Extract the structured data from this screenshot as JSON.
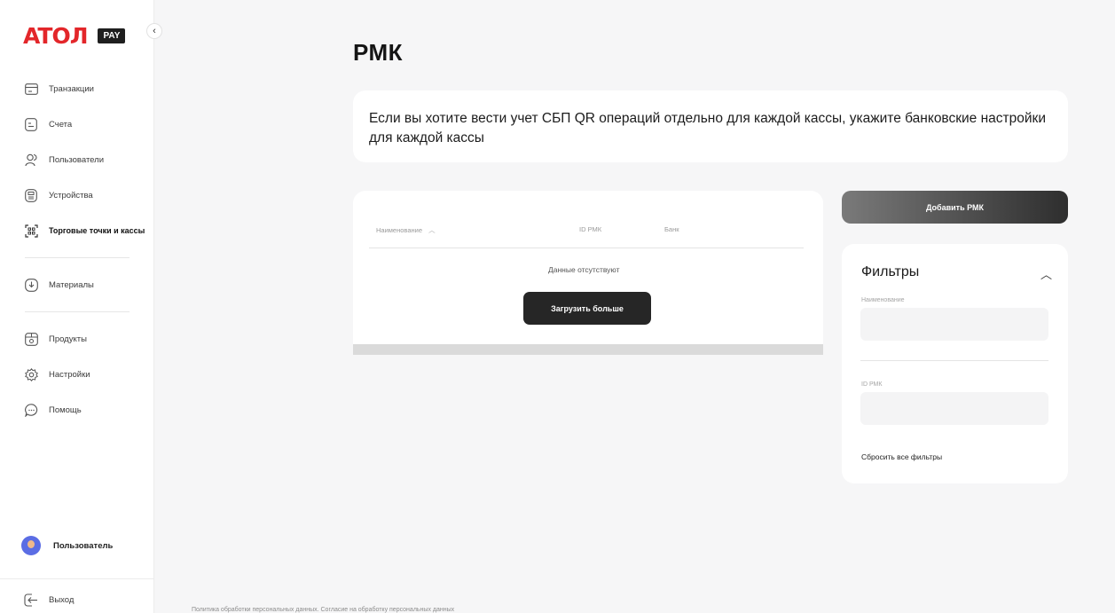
{
  "brand": {
    "logo_text": "ATOЛ",
    "badge": "PAY",
    "color": "#e3262a"
  },
  "sidebar": {
    "collapse": "‹",
    "items": [
      {
        "label": "Транзакции",
        "icon": "card-icon"
      },
      {
        "label": "Счета",
        "icon": "invoice-icon"
      },
      {
        "label": "Пользователи",
        "icon": "users-icon"
      },
      {
        "label": "Устройства",
        "icon": "device-icon"
      },
      {
        "label": "Торговые точки и кассы",
        "icon": "store-icon",
        "active": true
      },
      {
        "label": "Материалы",
        "icon": "materials-icon"
      },
      {
        "label": "Продукты",
        "icon": "products-icon"
      },
      {
        "label": "Настройки",
        "icon": "gear-icon"
      },
      {
        "label": "Помощь",
        "icon": "help-icon"
      }
    ],
    "user_name": "Пользователь",
    "logout": "Выход"
  },
  "page": {
    "title": "РМК",
    "info": "Если вы хотите вести учет СБП QR операций отдельно для каждой кассы, укажите банковские настройки для каждой кассы"
  },
  "table": {
    "columns": [
      "Наименование",
      "ID РМК",
      "Банк"
    ],
    "sort_icon": "︿",
    "empty_text": "Данные отсутствуют",
    "load_more": "Загрузить больше"
  },
  "actions": {
    "add_button": "Добавить РМК"
  },
  "filters": {
    "title": "Фильтры",
    "toggle": "︿",
    "name_label": "Наименование",
    "name_value": "",
    "id_label": "ID РМК",
    "id_value": "",
    "reset": "Сбросить все фильтры"
  },
  "footer": {
    "text": "Политика обработки персональных данных. Согласие на обработку персональных данных"
  }
}
